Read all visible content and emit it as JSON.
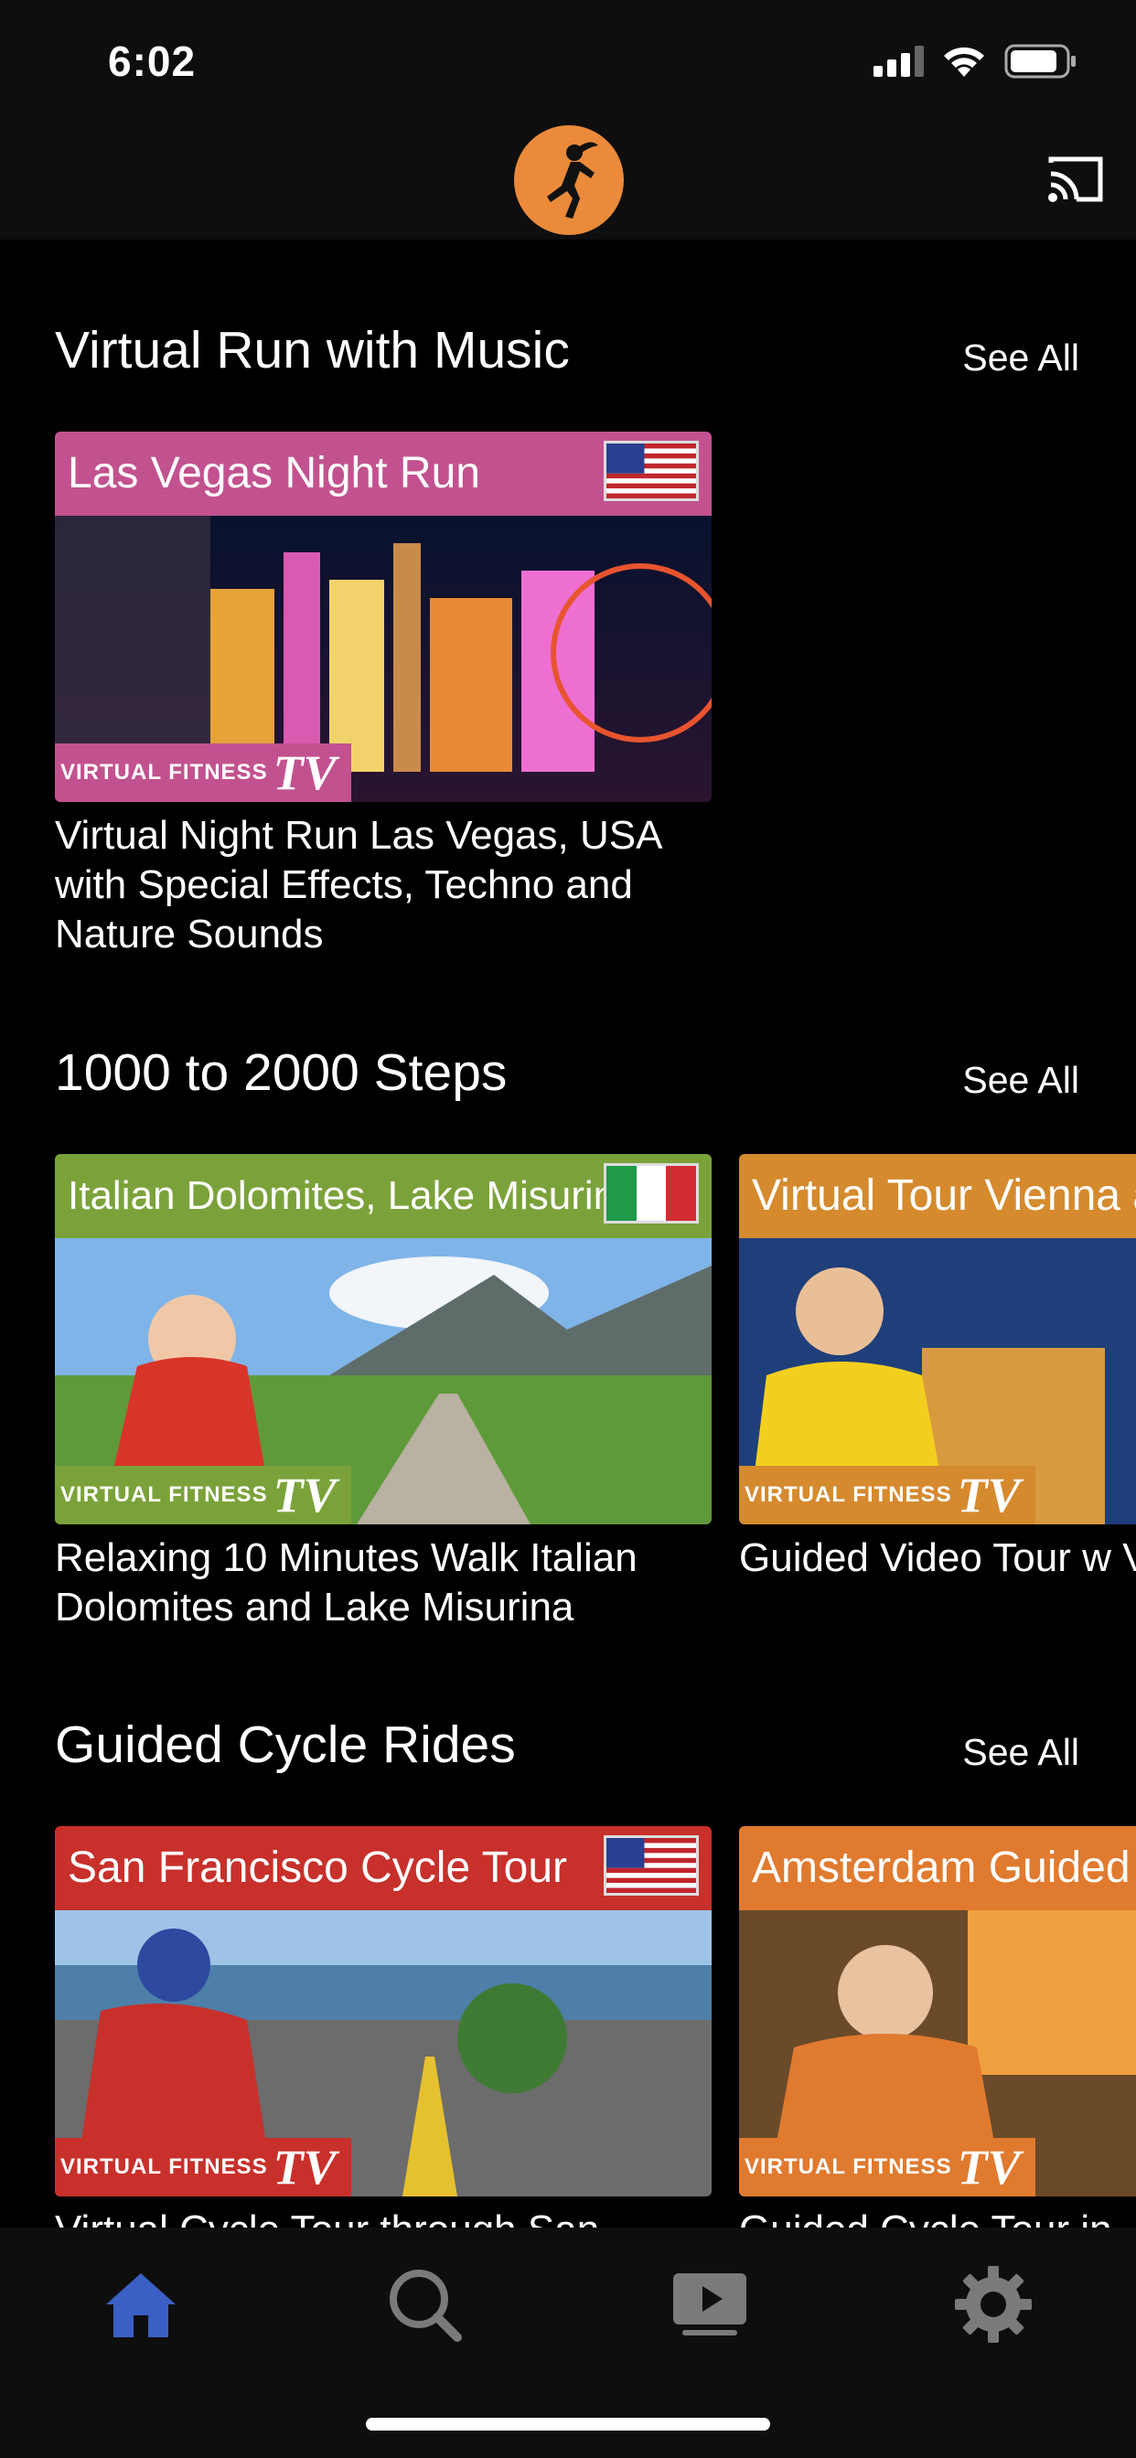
{
  "status": {
    "time": "6:02"
  },
  "icons": {
    "logo": "runner-logo-icon",
    "cast": "cast-icon",
    "tabs": [
      "home-icon",
      "search-icon",
      "video-library-icon",
      "gear-icon"
    ]
  },
  "colors": {
    "accent": "#ea8a3a",
    "tab_active": "#3b5fc4",
    "tab_inactive": "#7a7a7a"
  },
  "sections": [
    {
      "title": "Virtual Run with Music",
      "see_all": "See All",
      "cards": [
        {
          "thumb_title": "Las Vegas Night Run",
          "brand": "VIRTUAL FITNESS",
          "brand_tv": "TV",
          "title": "Virtual Night Run Las Vegas, USA with Special Effects, Techno and Nature Sounds"
        }
      ]
    },
    {
      "title": "1000 to 2000 Steps",
      "see_all": "See All",
      "cards": [
        {
          "thumb_title": "Italian Dolomites, Lake Misurina",
          "brand": "VIRTUAL FITNESS",
          "brand_tv": "TV",
          "title": "Relaxing 10 Minutes Walk Italian Dolomites and Lake Misurina"
        },
        {
          "thumb_title": "Virtual Tour Vienna a",
          "brand": "VIRTUAL FITNESS",
          "brand_tv": "TV",
          "title": "Guided Video Tour w Vienna at Night, Aus"
        }
      ]
    },
    {
      "title": "Guided Cycle Rides",
      "see_all": "See All",
      "cards": [
        {
          "thumb_title": "San Francisco Cycle Tour",
          "brand": "VIRTUAL FITNESS",
          "brand_tv": "TV",
          "title": "Virtual Cycle Tour through San"
        },
        {
          "thumb_title": "Amsterdam Guided",
          "brand": "VIRTUAL FITNESS",
          "brand_tv": "TV",
          "title": "Guided Cycle Tour in"
        }
      ]
    }
  ]
}
